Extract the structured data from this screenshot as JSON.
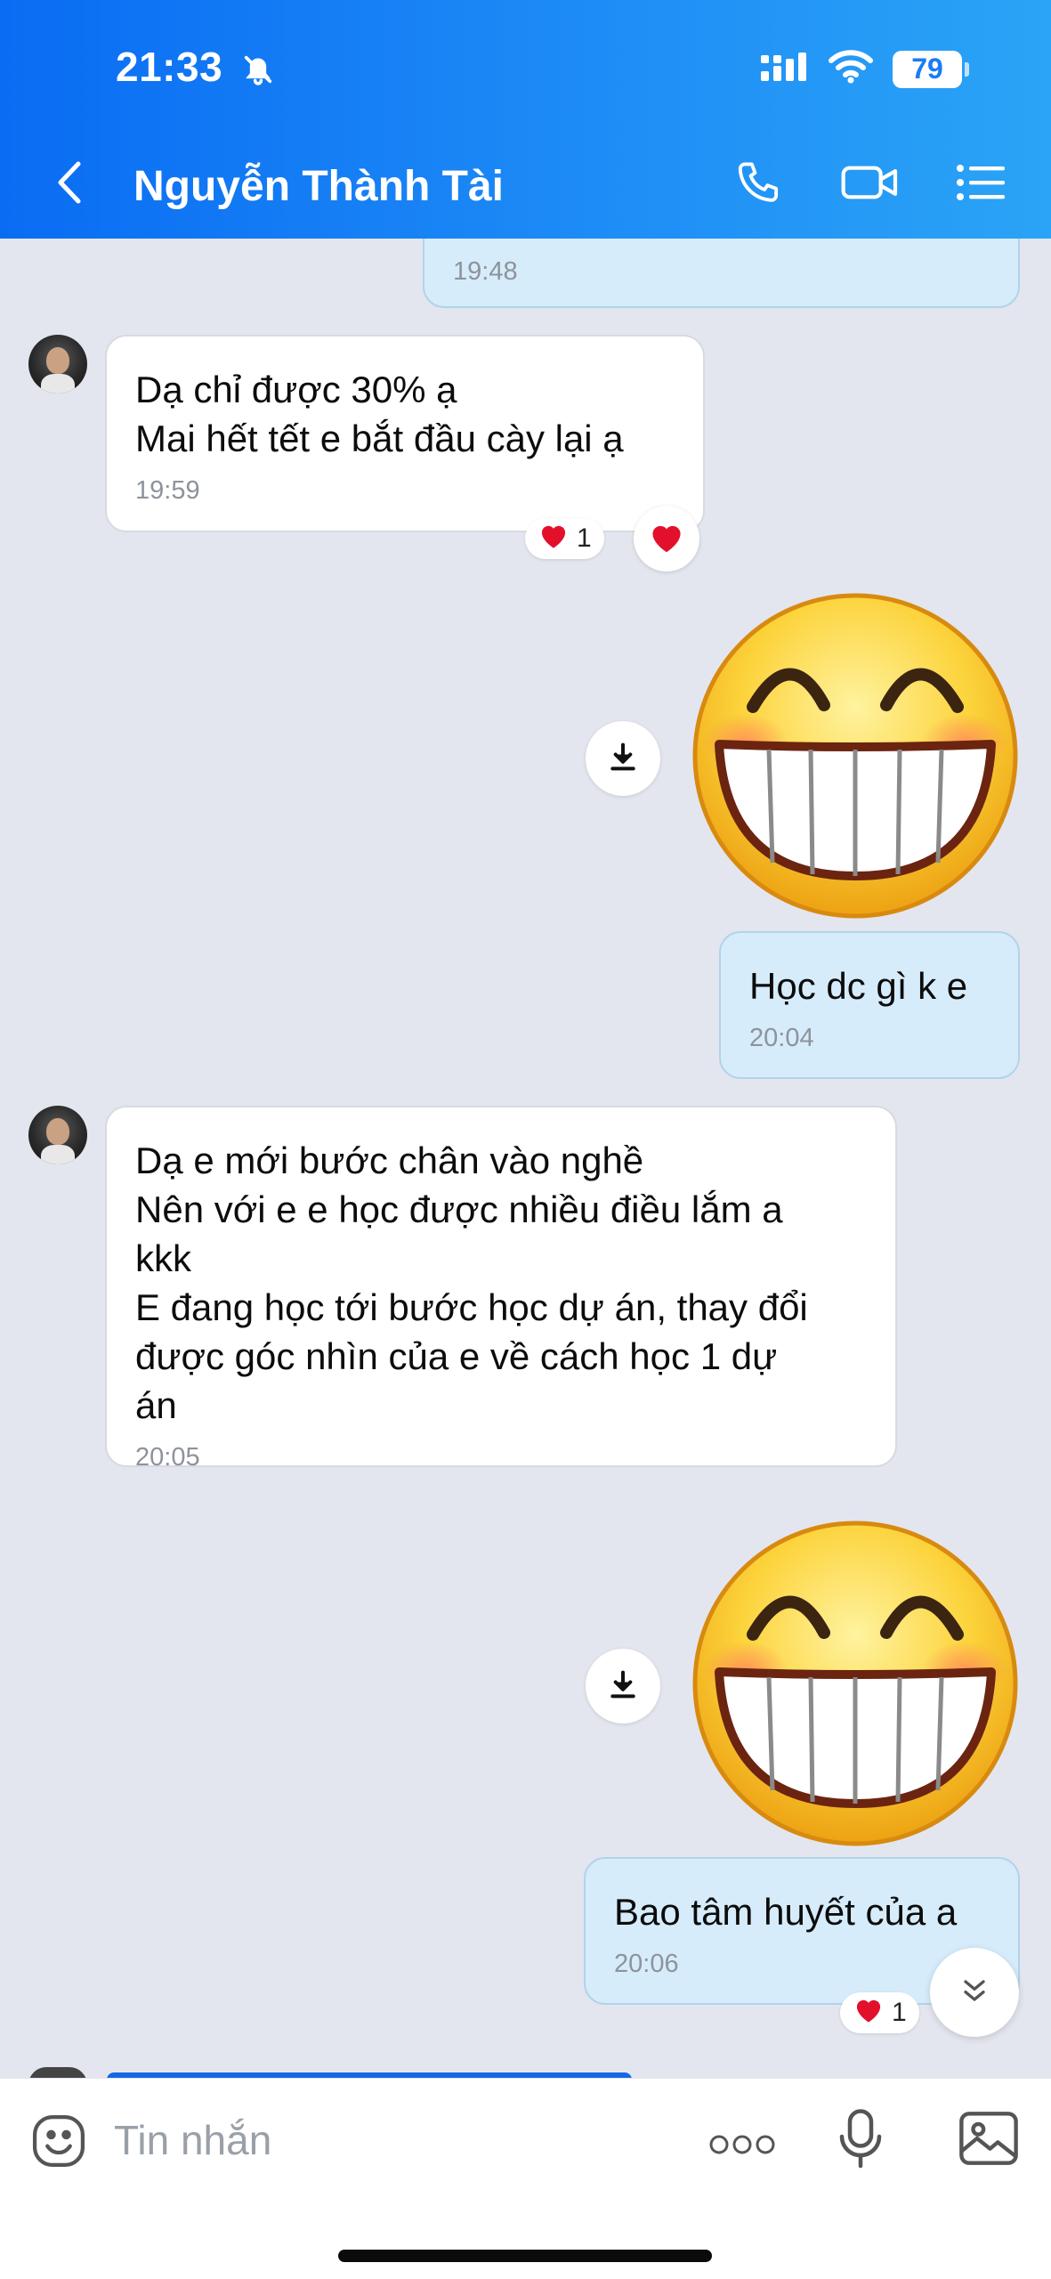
{
  "status_bar": {
    "time": "21:33",
    "battery": "79",
    "icons": [
      "bell-slash-icon",
      "cellular-icon",
      "wifi-icon",
      "battery-icon"
    ]
  },
  "header": {
    "contact_name": "Nguyễn Thành Tài",
    "icons": [
      "back-icon",
      "phone-icon",
      "video-call-icon",
      "menu-list-icon"
    ],
    "accent_color": "#1a7bf5"
  },
  "messages": [
    {
      "direction": "out",
      "type": "text",
      "text": "",
      "time": "19:48"
    },
    {
      "direction": "in",
      "type": "text",
      "lines": [
        "Dạ chỉ được 30% ạ",
        "Mai hết tết e bắt đầu cày lại ạ"
      ],
      "time": "19:59",
      "reaction": {
        "emoji": "heart",
        "count": "1"
      }
    },
    {
      "direction": "out",
      "type": "sticker",
      "sticker": "grinning-face-sticker"
    },
    {
      "direction": "out",
      "type": "text",
      "text": "Học dc gì k e",
      "time": "20:04"
    },
    {
      "direction": "in",
      "type": "text",
      "lines": [
        "Dạ e mới bước chân vào nghề",
        "Nên với e e học được nhiều điều lắm a",
        "kkk",
        "E đang học tới bước học dự án, thay đổi",
        "được góc nhìn của e về cách học 1 dự",
        "án"
      ],
      "time": "20:05"
    },
    {
      "direction": "out",
      "type": "sticker",
      "sticker": "grinning-face-sticker"
    },
    {
      "direction": "out",
      "type": "text",
      "text": "Bao tâm huyết của a",
      "time": "20:06",
      "reaction": {
        "emoji": "heart",
        "count": "1"
      }
    }
  ],
  "input_bar": {
    "placeholder": "Tin nhắn",
    "icons": [
      "emoji-icon",
      "more-dots-icon",
      "microphone-icon",
      "image-icon"
    ]
  }
}
